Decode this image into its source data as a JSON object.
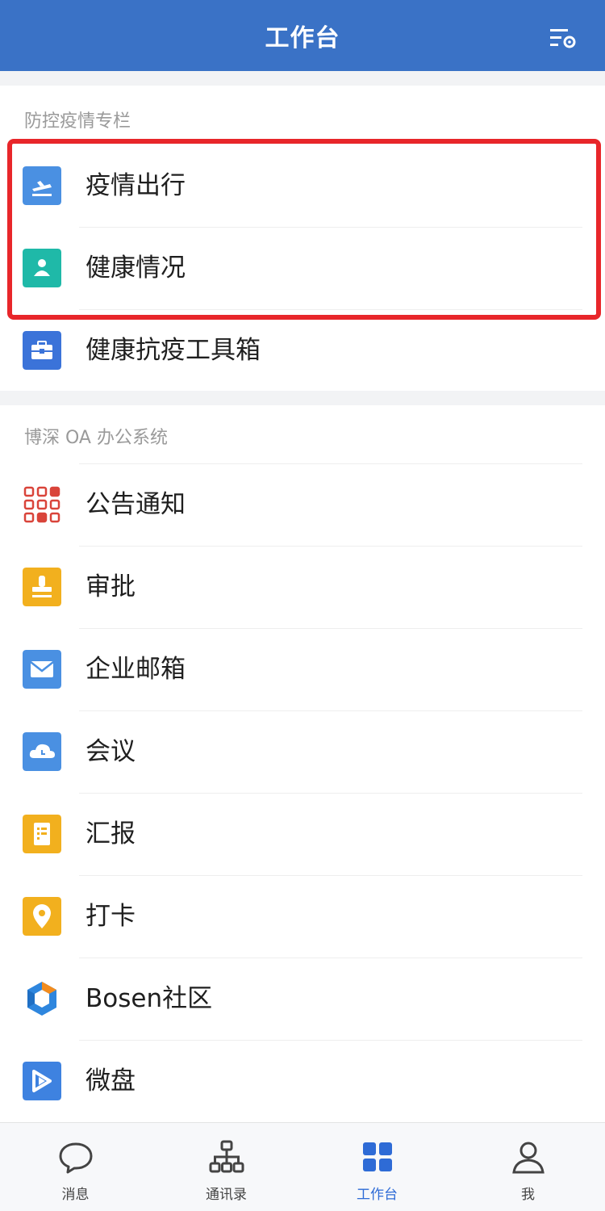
{
  "header": {
    "title": "工作台",
    "settings_icon": "filter-settings-icon"
  },
  "section_covid": {
    "title": "防控疫情专栏",
    "items": [
      {
        "label": "疫情出行",
        "icon": "plane-icon",
        "color": "#4a90e2"
      },
      {
        "label": "健康情况",
        "icon": "person-icon",
        "color": "#1fb9a8"
      },
      {
        "label": "健康抗疫工具箱",
        "icon": "toolbox-icon",
        "color": "#3b73d9"
      }
    ]
  },
  "section_oa": {
    "title": "博深 OA 办公系统",
    "items": [
      {
        "label": "公告通知",
        "icon": "notice-grid-icon",
        "color": "#d9443a"
      },
      {
        "label": "审批",
        "icon": "stamp-icon",
        "color": "#f2b01e"
      },
      {
        "label": "企业邮箱",
        "icon": "mail-icon",
        "color": "#4a90e2"
      },
      {
        "label": "会议",
        "icon": "cloud-icon",
        "color": "#4a90e2"
      },
      {
        "label": "汇报",
        "icon": "report-icon",
        "color": "#f2b01e"
      },
      {
        "label": "打卡",
        "icon": "location-pin-icon",
        "color": "#f2b01e"
      },
      {
        "label": "Bosen社区",
        "icon": "bosen-logo-icon",
        "color": "#2e86de"
      },
      {
        "label": "微盘",
        "icon": "drive-icon",
        "color": "#3e82e0"
      }
    ]
  },
  "tabbar": {
    "tabs": [
      {
        "label": "消息",
        "icon": "chat-bubble-icon"
      },
      {
        "label": "通讯录",
        "icon": "org-chart-icon"
      },
      {
        "label": "工作台",
        "icon": "grid-icon",
        "active": true
      },
      {
        "label": "我",
        "icon": "user-icon"
      }
    ]
  },
  "highlight_color": "#e8262a",
  "accent_color": "#3a72c6"
}
